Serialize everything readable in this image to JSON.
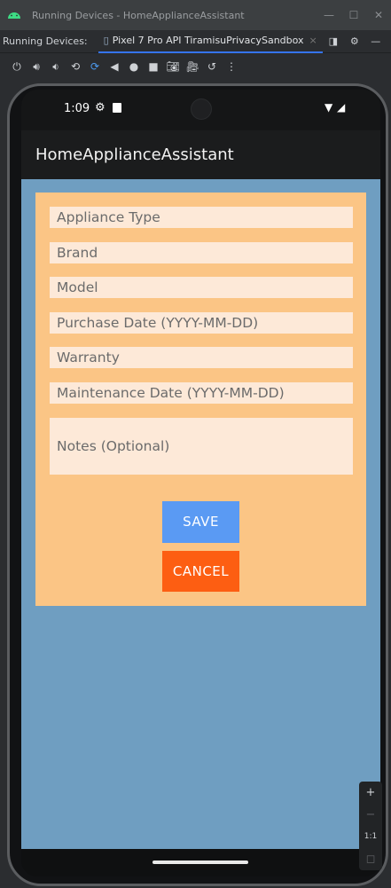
{
  "window": {
    "title": "Running Devices - HomeApplianceAssistant",
    "controls": {
      "minimize": "—",
      "maximize": "☐",
      "close": "✕"
    }
  },
  "tabbar": {
    "label": "Running Devices:",
    "active_tab": "Pixel 7 Pro API TiramisuPrivacySandbox",
    "tab_close": "×"
  },
  "device": {
    "status": {
      "time": "1:09"
    },
    "app_title": "HomeApplianceAssistant",
    "form": {
      "appliance_type_placeholder": "Appliance Type",
      "brand_placeholder": "Brand",
      "model_placeholder": "Model",
      "purchase_date_placeholder": "Purchase Date (YYYY-MM-DD)",
      "warranty_placeholder": "Warranty",
      "maintenance_date_placeholder": "Maintenance Date (YYYY-MM-DD)",
      "notes_placeholder": "Notes (Optional)",
      "save_label": "SAVE",
      "cancel_label": "CANCEL"
    },
    "colors": {
      "content_bg": "#6f9ec1",
      "card_bg": "#fbc585",
      "field_bg": "#fde9d8",
      "save_bg": "#5a9af3",
      "cancel_bg": "#fd5e12"
    }
  },
  "zoom": {
    "zoom_in": "+",
    "zoom_out": "−",
    "actual_size": "1:1",
    "fit": "◻"
  }
}
